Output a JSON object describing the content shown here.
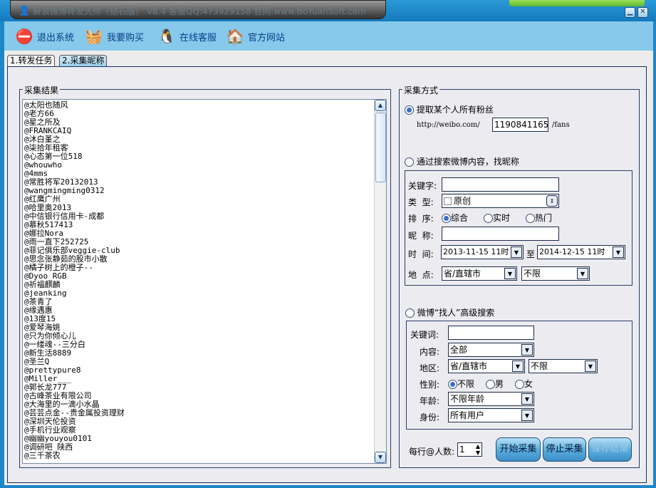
{
  "window": {
    "title": "新浪微博转发大师（钻石版） V8.4 客服QQ:473929158 官网:www.BoYuanSoft.com",
    "minimize": "▁",
    "close": "✕"
  },
  "toolbar": [
    {
      "label": "退出系统",
      "icon": "exit-user-icon",
      "glyph": "⛔"
    },
    {
      "label": "我要购买",
      "icon": "shopping-basket-icon",
      "glyph": "🧺"
    },
    {
      "label": "在线客服",
      "icon": "qq-penguin-icon",
      "glyph": "🐧"
    },
    {
      "label": "官方网站",
      "icon": "home-icon",
      "glyph": "🏠"
    }
  ],
  "tabs": [
    {
      "label": "1.转发任务"
    },
    {
      "label": "2.采集昵称"
    }
  ],
  "results": {
    "title": "采集结果",
    "items": [
      "@太阳也随风",
      "@老方66",
      "@星之所及",
      "@FRANKCAIQ",
      "@沐白堇之",
      "@柒拾年租客",
      "@心态第一位518",
      "@whouwho",
      "@4mms",
      "@常胜将军20132013",
      "@wangmingming0312",
      "@红鹰广州",
      "@哈里奥2013",
      "@中信银行信用卡-成都",
      "@慕秋517413",
      "@娜拉Nora",
      "@雨一直下252725",
      "@菲记俱乐部veggie-club",
      "@思念张静茹的股市小散",
      "@橘子树上的橙子--",
      "@Dyoo_RGB",
      "@祈福麒麟",
      "@jeanking",
      "@茶青了",
      "@缘遇惠",
      "@13度15",
      "@爱琴海姚",
      "@只为你倾心儿",
      "@一缕魂--三分白",
      "@新生活8889",
      "@圣兰Q",
      "@prettypure8",
      "@Miller___",
      "@郭长龙777",
      "@古峰茶业有限公司",
      "@大海里的一滴小水晶",
      "@芸芸点金--贵金属投资理财",
      "@深圳天伦投资",
      "@手机行业观察",
      "@幽幽youyou0101",
      "@调研吧_陕西",
      "@三千茶农"
    ]
  },
  "method": {
    "title": "采集方式",
    "fans": {
      "label": "提取某个人所有粉丝",
      "selected": true,
      "prefix": "http://weibo.com/",
      "uid": "1190841165",
      "suffix": "/fans"
    },
    "search": {
      "label": "通过搜索微博内容，找昵称",
      "selected": false,
      "keyword_label": "关键字:",
      "keyword": "",
      "type_label": "类  型:",
      "type_value": "原创",
      "sort_label": "排  序:",
      "sort_options": [
        "综合",
        "实时",
        "热门"
      ],
      "sort_selected": "综合",
      "nick_label": "昵  称:",
      "nick": "",
      "time_label": "时  间:",
      "time_from": "2013-11-15 11时",
      "time_to_label": "至",
      "time_to": "2014-12-15 11时",
      "place_label": "地  点:",
      "province": "省/直辖市",
      "city": "不限"
    },
    "people": {
      "label": "微博“找人”高级搜索",
      "selected": false,
      "keyword_label": "关键词:",
      "keyword": "",
      "content_label": "内容:",
      "content": "全部",
      "region_label": "地区:",
      "province": "省/直辖市",
      "city": "不限",
      "gender_label": "性别:",
      "gender_options": [
        "不限",
        "男",
        "女"
      ],
      "gender_selected": "不限",
      "age_label": "年龄:",
      "age": "不限年龄",
      "identity_label": "身份:",
      "identity": "所有用户"
    },
    "per_line_label": "每行@人数:",
    "per_line": "1",
    "start": "开始采集",
    "stop": "停止采集",
    "save": "保存结果"
  }
}
